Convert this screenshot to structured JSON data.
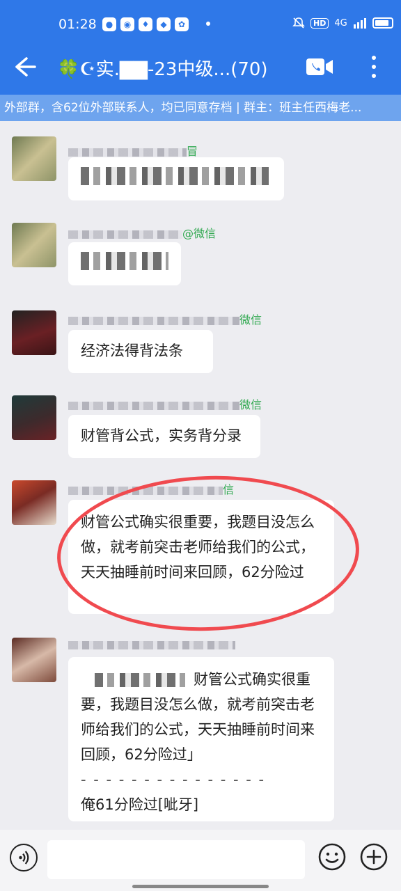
{
  "status_bar": {
    "time": "01:28",
    "network": "4G",
    "hd_label": "HD"
  },
  "header": {
    "emoji_prefix": "🍀☪",
    "title": "实.▇▇-23中级...(70)",
    "notice": "外部群，含62位外部联系人，均已同意存档 | 群主：班主任西梅老..."
  },
  "messages": [
    {
      "sender_suffix": "冒",
      "text": "",
      "avatar_color": "#a7a67a",
      "blurred": true
    },
    {
      "sender_suffix": "@微信",
      "text": "",
      "avatar_color": "#a4a374",
      "blurred": true
    },
    {
      "sender_suffix": "微信",
      "text": "经济法得背法条",
      "avatar_color": "#5a1e22"
    },
    {
      "sender_suffix": "微信",
      "text": "财管背公式，实务背分录",
      "avatar_color": "#3b2a2c"
    },
    {
      "sender_suffix": "信",
      "text": "财管公式确实很重要，我题目没怎么做，就考前突击老师给我们的公式，天天抽睡前时间来回顾，62分险过",
      "avatar_color": "#b2392d",
      "highlighted": true
    },
    {
      "sender_suffix": "",
      "quote": "财管公式确实很重要，我题目没怎么做，就考前突击老师给我们的公式，天天抽睡前时间来回顾，62分险过」",
      "divider": "- - - - - - - - - - - - - - -",
      "text": "俺61分险过[呲牙]",
      "avatar_color": "#6e3a2c"
    }
  ],
  "input": {
    "placeholder": ""
  },
  "colors": {
    "header_bg": "#2f78e8",
    "notice_bg": "#6ea4ee",
    "highlight": "#f04a4f",
    "sender_green": "#2fa84f"
  }
}
